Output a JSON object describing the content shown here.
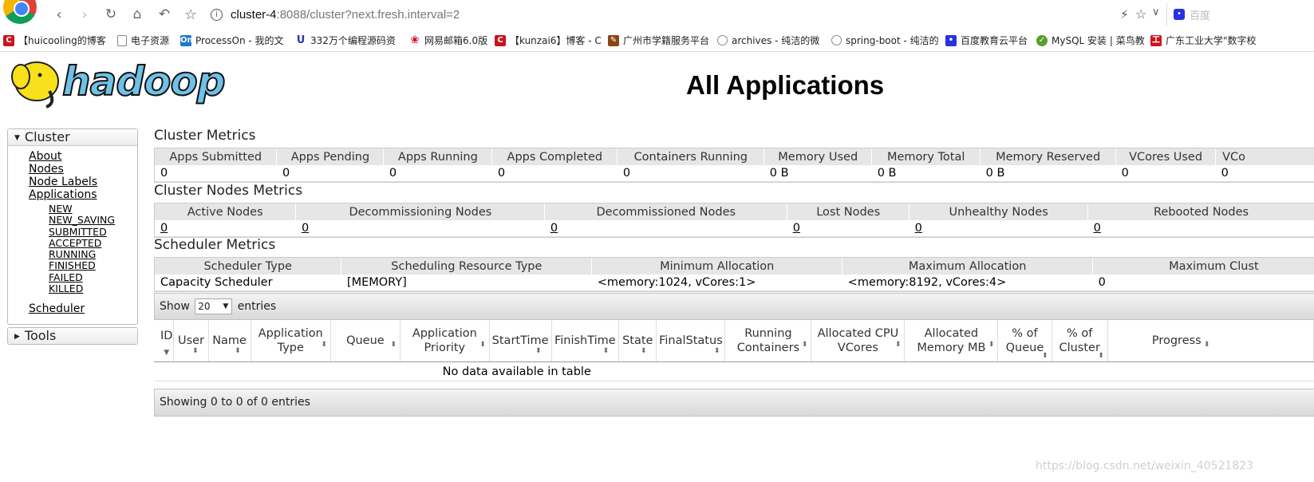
{
  "browser": {
    "url_host": "cluster-4",
    "url_rest": ":8088/cluster?next.fresh.interval=2",
    "search_engine": "百度",
    "bookmarks": [
      {
        "icon": "c-icon",
        "label": "【huicooling的博客"
      },
      {
        "icon": "file-icon",
        "label": "电子资源"
      },
      {
        "icon": "on-icon",
        "label": "ProcessOn - 我的文"
      },
      {
        "icon": "u-icon",
        "label": "332万个编程源码资"
      },
      {
        "icon": "mail-icon",
        "label": "网易邮箱6.0版"
      },
      {
        "icon": "c-icon",
        "label": "【kunzai6】博客 - C"
      },
      {
        "icon": "study-icon",
        "label": "广州市学籍服务平台"
      },
      {
        "icon": "globe-icon",
        "label": "archives - 纯洁的微"
      },
      {
        "icon": "globe-icon",
        "label": "spring-boot - 纯洁的"
      },
      {
        "icon": "baidu-icon",
        "label": "百度教育云平台"
      },
      {
        "icon": "mysql-icon",
        "label": "MySQL 安装 | 菜鸟教"
      },
      {
        "icon": "gdut-icon",
        "label": "广东工业大学\"数字校"
      }
    ]
  },
  "page": {
    "logo_text": "hadoop",
    "title": "All Applications"
  },
  "sidebar": {
    "cluster_label": "Cluster",
    "links": [
      "About",
      "Nodes",
      "Node Labels",
      "Applications"
    ],
    "app_states": [
      "NEW",
      "NEW_SAVING",
      "SUBMITTED",
      "ACCEPTED",
      "RUNNING",
      "FINISHED",
      "FAILED",
      "KILLED"
    ],
    "scheduler_label": "Scheduler",
    "tools_label": "Tools"
  },
  "cluster_metrics": {
    "title": "Cluster Metrics",
    "headers": [
      "Apps Submitted",
      "Apps Pending",
      "Apps Running",
      "Apps Completed",
      "Containers Running",
      "Memory Used",
      "Memory Total",
      "Memory Reserved",
      "VCores Used",
      "VCo"
    ],
    "values": [
      "0",
      "0",
      "0",
      "0",
      "0",
      "0 B",
      "0 B",
      "0 B",
      "0",
      "0"
    ]
  },
  "nodes_metrics": {
    "title": "Cluster Nodes Metrics",
    "headers": [
      "Active Nodes",
      "Decommissioning Nodes",
      "Decommissioned Nodes",
      "Lost Nodes",
      "Unhealthy Nodes",
      "Rebooted Nodes"
    ],
    "values": [
      "0",
      "0",
      "0",
      "0",
      "0",
      "0"
    ]
  },
  "scheduler_metrics": {
    "title": "Scheduler Metrics",
    "headers": [
      "Scheduler Type",
      "Scheduling Resource Type",
      "Minimum Allocation",
      "Maximum Allocation",
      "Maximum Clust"
    ],
    "values": [
      "Capacity Scheduler",
      "[MEMORY]",
      "<memory:1024, vCores:1>",
      "<memory:8192, vCores:4>",
      "0"
    ]
  },
  "apps_table": {
    "show_label": "Show",
    "page_length": "20",
    "entries_label": "entries",
    "headers": [
      {
        "line1": "ID",
        "line2": ""
      },
      {
        "line1": "User",
        "line2": ""
      },
      {
        "line1": "Name",
        "line2": ""
      },
      {
        "line1": "Application",
        "line2": "Type"
      },
      {
        "line1": "Queue",
        "line2": ""
      },
      {
        "line1": "Application",
        "line2": "Priority"
      },
      {
        "line1": "StartTime",
        "line2": ""
      },
      {
        "line1": "FinishTime",
        "line2": ""
      },
      {
        "line1": "State",
        "line2": ""
      },
      {
        "line1": "FinalStatus",
        "line2": ""
      },
      {
        "line1": "Running",
        "line2": "Containers"
      },
      {
        "line1": "Allocated CPU",
        "line2": "VCores"
      },
      {
        "line1": "Allocated",
        "line2": "Memory MB"
      },
      {
        "line1": "% of",
        "line2": "Queue"
      },
      {
        "line1": "% of",
        "line2": "Cluster"
      },
      {
        "line1": "Progress",
        "line2": ""
      }
    ],
    "empty_message": "No data available in table",
    "info": "Showing 0 to 0 of 0 entries"
  },
  "watermark": "https://blog.csdn.net/weixin_40521823"
}
